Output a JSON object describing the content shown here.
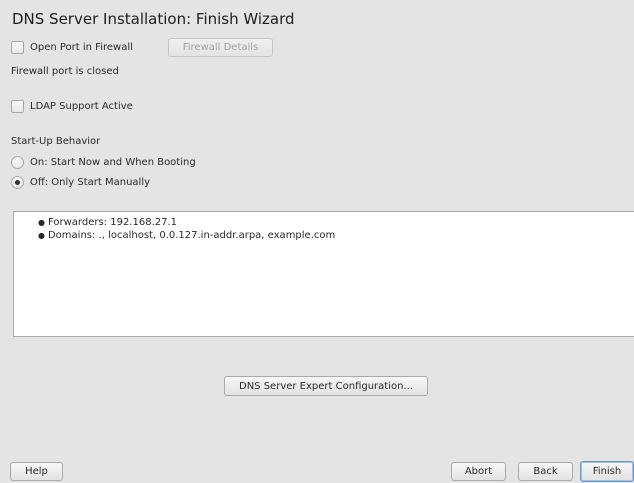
{
  "window": {
    "title": "DNS Server Installation: Finish Wizard"
  },
  "firewall": {
    "open_port_label": "Open Port in Firewall",
    "open_port_checked": false,
    "details_button_label": "Firewall Details",
    "status_text": "Firewall port is closed"
  },
  "ldap": {
    "label": "LDAP Support Active",
    "checked": false
  },
  "startup": {
    "heading": "Start-Up Behavior",
    "options": [
      {
        "label": "On: Start Now and When Booting",
        "selected": false
      },
      {
        "label": "Off: Only Start Manually",
        "selected": true
      }
    ]
  },
  "summary": {
    "items": [
      "Forwarders: 192.168.27.1",
      "Domains: ., localhost, 0.0.127.in-addr.arpa, example.com"
    ]
  },
  "expert_button_label": "DNS Server Expert Configuration...",
  "footer": {
    "help_label": "Help",
    "abort_label": "Abort",
    "back_label": "Back",
    "finish_label": "Finish"
  }
}
